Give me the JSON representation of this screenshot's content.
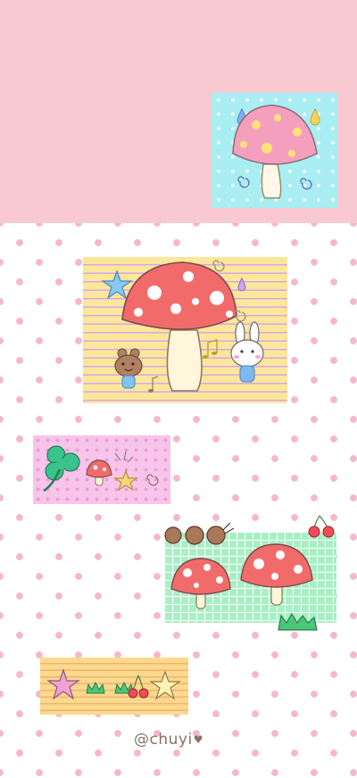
{
  "wallpaper": {
    "signature": "@chuyi",
    "heart_icon": "♥",
    "colors": {
      "top_band": "#f9c9d2",
      "polka_dot": "#f6b8c9",
      "blue_card": "#a8eef2",
      "yellow_card": "#fbe79a",
      "pink_card": "#f7c4ea",
      "green_card": "#a8f0c4",
      "orange_card": "#fbd98f",
      "mushroom_red": "#f26b6b"
    },
    "icons": [
      "mushroom-icon",
      "bear-icon",
      "bunny-icon",
      "star-icon",
      "clover-icon",
      "cherry-icon",
      "ant-icon",
      "raindrop-icon",
      "music-note-icon",
      "grass-icon"
    ]
  }
}
